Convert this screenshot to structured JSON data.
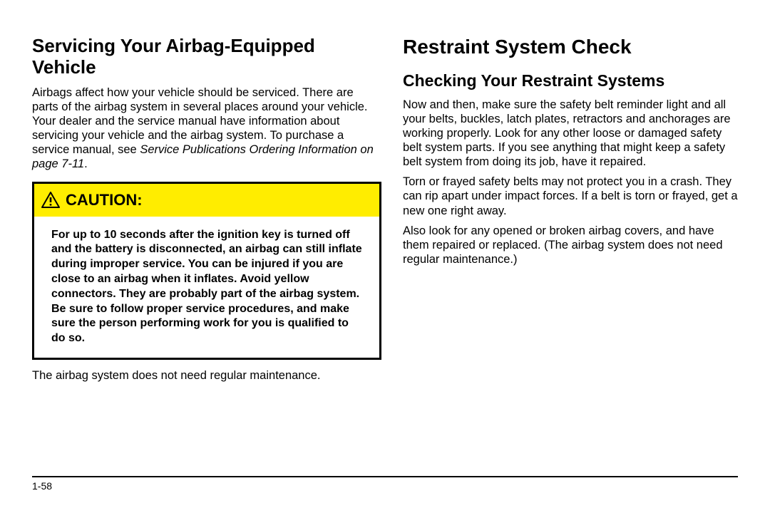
{
  "left": {
    "heading": "Servicing Your Airbag-Equipped Vehicle",
    "para1_a": "Airbags affect how your vehicle should be serviced. There are parts of the airbag system in several places around your vehicle. Your dealer and the service manual have information about servicing your vehicle and the airbag system. To purchase a service manual, see ",
    "para1_b": "Service Publications Ordering Information on page 7-11",
    "para1_c": ".",
    "caution_label": "CAUTION:",
    "caution_body": "For up to 10 seconds after the ignition key is turned off and the battery is disconnected, an airbag can still inflate during improper service. You can be injured if you are close to an airbag when it inflates. Avoid yellow connectors. They are probably part of the airbag system. Be sure to follow proper service procedures, and make sure the person performing work for you is qualified to do so.",
    "after_caution": "The airbag system does not need regular maintenance."
  },
  "right": {
    "section_title": "Restraint System Check",
    "subheading": "Checking Your Restraint Systems",
    "para1": "Now and then, make sure the safety belt reminder light and all your belts, buckles, latch plates, retractors and anchorages are working properly. Look for any other loose or damaged safety belt system parts. If you see anything that might keep a safety belt system from doing its job, have it repaired.",
    "para2": "Torn or frayed safety belts may not protect you in a crash. They can rip apart under impact forces. If a belt is torn or frayed, get a new one right away.",
    "para3": "Also look for any opened or broken airbag covers, and have them repaired or replaced. (The airbag system does not need regular maintenance.)"
  },
  "page_number": "1-58"
}
